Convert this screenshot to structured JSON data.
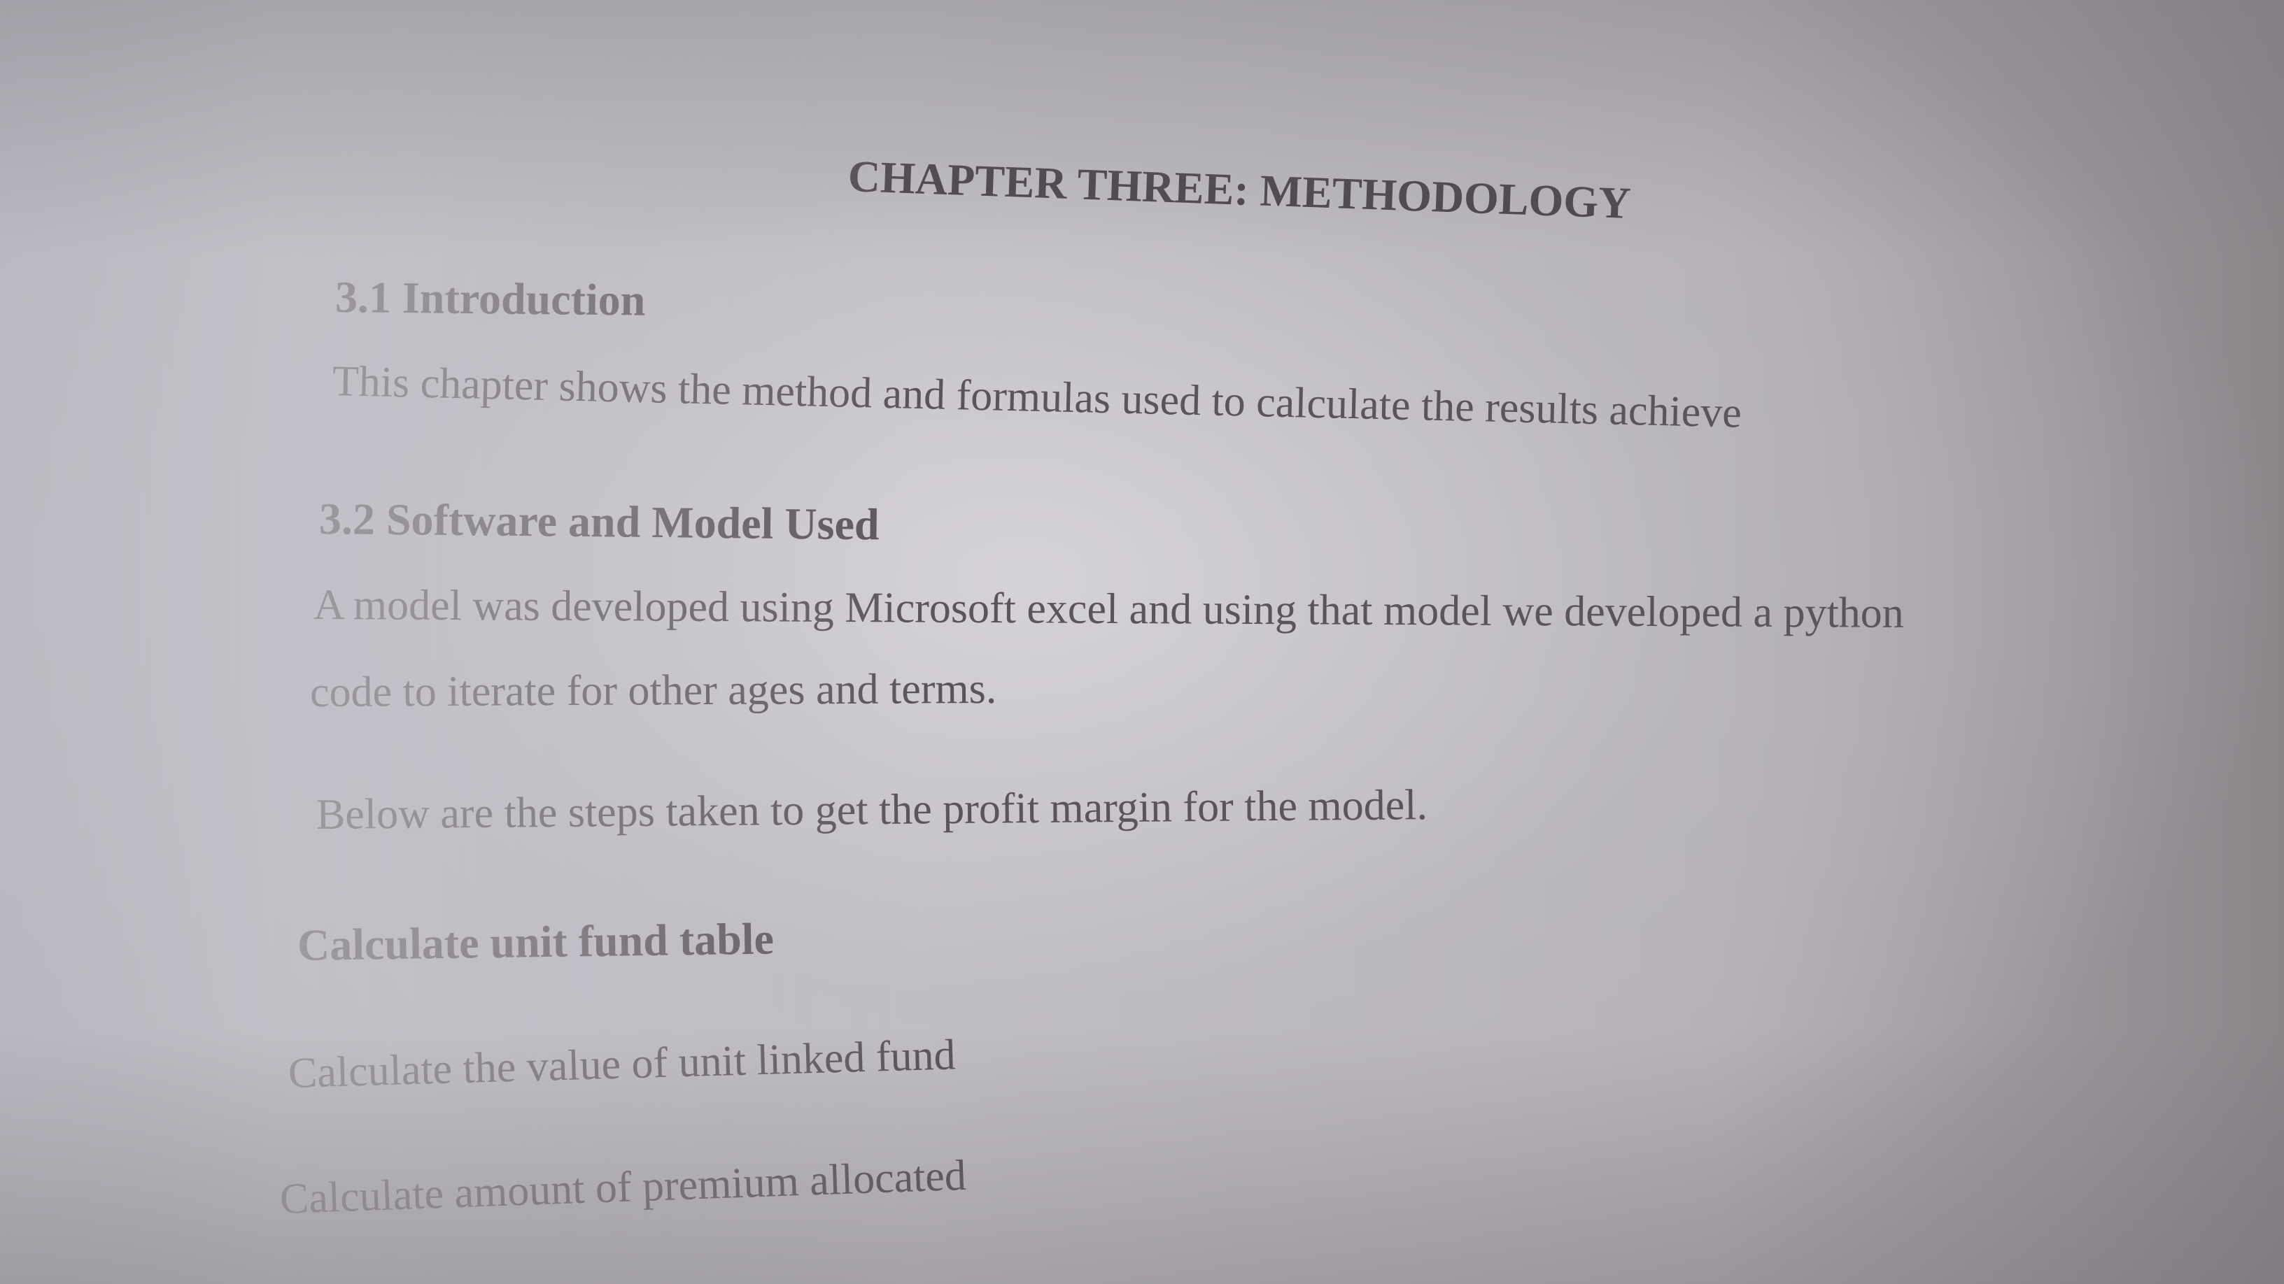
{
  "document": {
    "title": "CHAPTER THREE: METHODOLOGY",
    "sections": [
      {
        "heading": "3.1 Introduction",
        "body": "This chapter shows the method and formulas used to calculate the results achieve"
      },
      {
        "heading": "3.2 Software and Model Used",
        "body_line1": "A model was developed using Microsoft excel and using that model we developed a python",
        "body_line2": "code to iterate for other ages and terms.",
        "steps_intro": "Below are the steps taken to get the profit margin for the model."
      }
    ],
    "steps_heading": "Calculate unit fund table",
    "steps": [
      "Calculate the value of unit linked fund",
      "Calculate amount of premium allocated"
    ]
  }
}
